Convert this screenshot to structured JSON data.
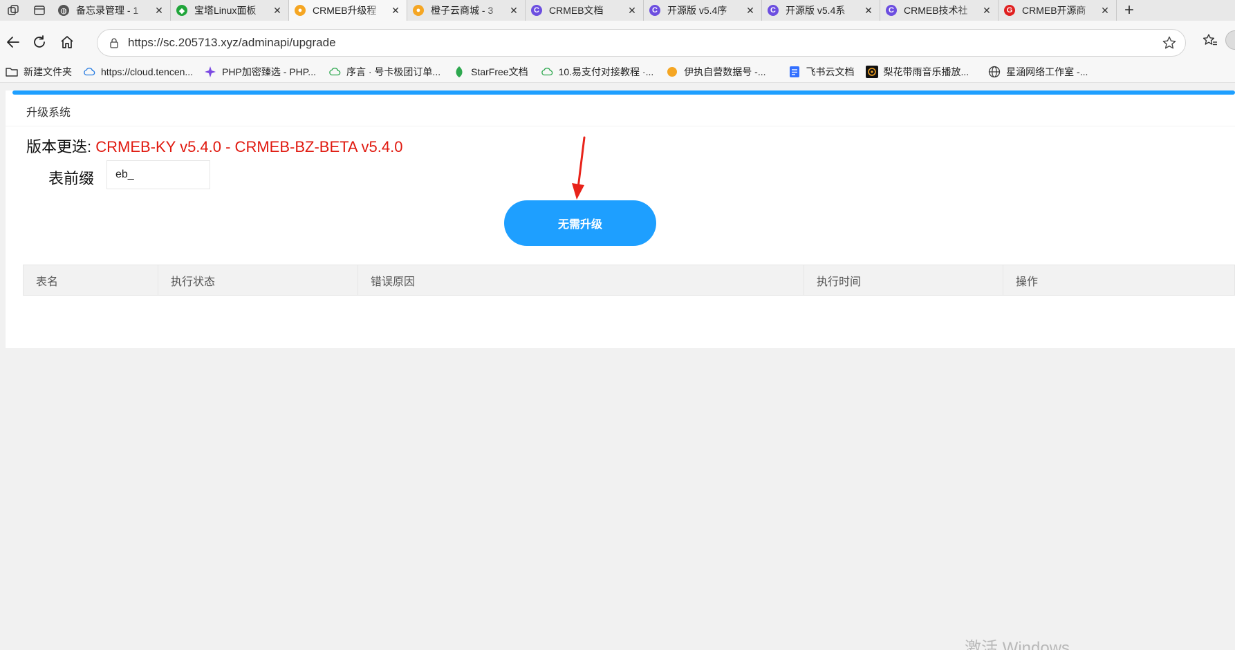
{
  "tabs": [
    {
      "title": "备忘录管理 - 1",
      "icon": "globe-icon",
      "color": "#555555",
      "active": false
    },
    {
      "title": "宝塔Linux面板",
      "icon": "baota-shield-icon",
      "color": "#20a53a",
      "active": false
    },
    {
      "title": "CRMEB升级程",
      "icon": "crmeb-bird-icon",
      "color": "#f5a623",
      "active": true
    },
    {
      "title": "橙子云商城 - 3",
      "icon": "crmeb-bird-icon",
      "color": "#f5a623",
      "active": false
    },
    {
      "title": "CRMEB文档",
      "icon": "crmeb-c-icon",
      "color": "#6c4ee0",
      "active": false
    },
    {
      "title": "开源版 v5.4序",
      "icon": "crmeb-c-icon",
      "color": "#6c4ee0",
      "active": false
    },
    {
      "title": "开源版 v5.4系",
      "icon": "crmeb-c-icon",
      "color": "#6c4ee0",
      "active": false
    },
    {
      "title": "CRMEB技术社",
      "icon": "crmeb-c-icon",
      "color": "#6c4ee0",
      "active": false
    },
    {
      "title": "CRMEB开源商",
      "icon": "crmeb-g-icon",
      "color": "#e02020",
      "active": false
    }
  ],
  "address": {
    "url": "https://sc.205713.xyz/adminapi/upgrade"
  },
  "bookmarks": [
    {
      "label": "新建文件夹",
      "icon": "folder-icon",
      "color": "#333333"
    },
    {
      "label": "https://cloud.tencen...",
      "icon": "cloud-icon",
      "color": "#2a7de1"
    },
    {
      "label": "PHP加密臻选 - PHP...",
      "icon": "php-sparkle-icon",
      "color": "#7b4ae2"
    },
    {
      "label": "序言 · 号卡极团订单...",
      "icon": "green-cloud-icon",
      "color": "#2ea84f"
    },
    {
      "label": "StarFree文档",
      "icon": "green-leaf-icon",
      "color": "#2ea84f"
    },
    {
      "label": "10.易支付对接教程 ·...",
      "icon": "green-cloud-icon",
      "color": "#2ea84f"
    },
    {
      "label": "伊执自营数据号 -...",
      "icon": "crmeb-bird-icon",
      "color": "#f5a623"
    },
    {
      "label": "飞书云文档",
      "icon": "doc-icon",
      "color": "#3370ff"
    },
    {
      "label": "梨花带雨音乐播放...",
      "icon": "music-icon",
      "color": "#f0a020"
    },
    {
      "label": "星涵网络工作室 -...",
      "icon": "globe-icon",
      "color": "#333333"
    }
  ],
  "page": {
    "header": "升级系统",
    "version_label": "版本更迭: ",
    "version_value": "CRMEB-KY v5.4.0 - CRMEB-BZ-BETA v5.4.0",
    "prefix_label": "表前缀",
    "prefix_value": "eb_",
    "button_label": "无需升级",
    "accent_color": "#1e9fff",
    "version_color": "#e0190f",
    "table_headers": [
      "表名",
      "执行状态",
      "错误原因",
      "执行时间",
      "操作"
    ]
  },
  "watermark": "激活 Windows"
}
